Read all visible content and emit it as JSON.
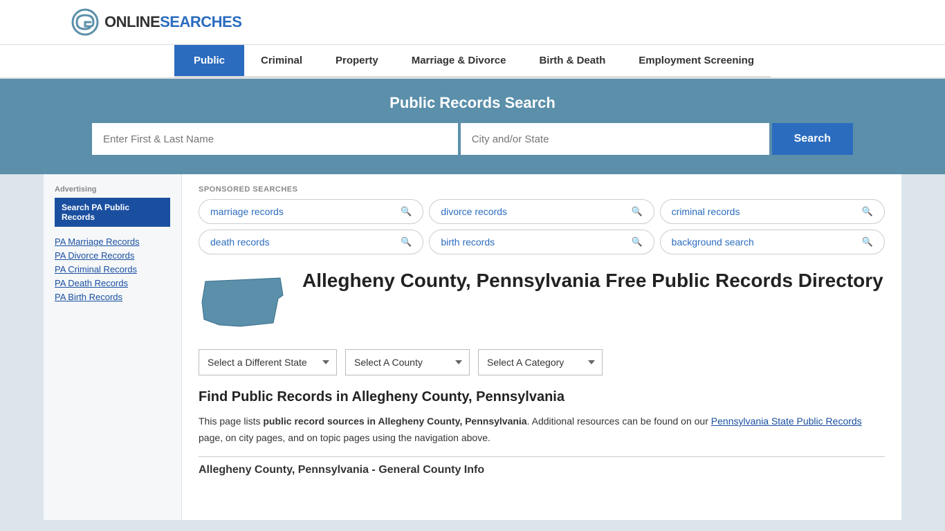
{
  "header": {
    "logo_text_black": "ONLINE",
    "logo_text_blue": "SEARCHES",
    "logo_alt": "OnlineSearches Logo"
  },
  "nav": {
    "items": [
      {
        "label": "Public",
        "active": true
      },
      {
        "label": "Criminal",
        "active": false
      },
      {
        "label": "Property",
        "active": false
      },
      {
        "label": "Marriage & Divorce",
        "active": false
      },
      {
        "label": "Birth & Death",
        "active": false
      },
      {
        "label": "Employment Screening",
        "active": false
      }
    ]
  },
  "search_banner": {
    "title": "Public Records Search",
    "name_placeholder": "Enter First & Last Name",
    "location_placeholder": "City and/or State",
    "button_label": "Search"
  },
  "sponsored": {
    "label": "SPONSORED SEARCHES",
    "tags": [
      {
        "label": "marriage records"
      },
      {
        "label": "divorce records"
      },
      {
        "label": "criminal records"
      },
      {
        "label": "death records"
      },
      {
        "label": "birth records"
      },
      {
        "label": "background search"
      }
    ]
  },
  "county": {
    "title": "Allegheny County, Pennsylvania Free Public Records Directory"
  },
  "dropdowns": {
    "state": "Select a Different State",
    "county": "Select A County",
    "category": "Select A Category"
  },
  "sidebar": {
    "ad_label": "Advertising",
    "ad_button": "Search PA Public Records",
    "links": [
      "PA Marriage Records",
      "PA Divorce Records",
      "PA Criminal Records",
      "PA Death Records",
      "PA Birth Records"
    ]
  },
  "find_records": {
    "title": "Find Public Records in Allegheny County, Pennsylvania",
    "body_start": "This page lists ",
    "body_bold": "public record sources in Allegheny County, Pennsylvania",
    "body_middle": ". Additional resources can be found on our ",
    "body_link": "Pennsylvania State Public Records",
    "body_end": " page, on city pages, and on topic pages using the navigation above."
  },
  "section_bottom": {
    "title": "Allegheny County, Pennsylvania - General County Info"
  }
}
